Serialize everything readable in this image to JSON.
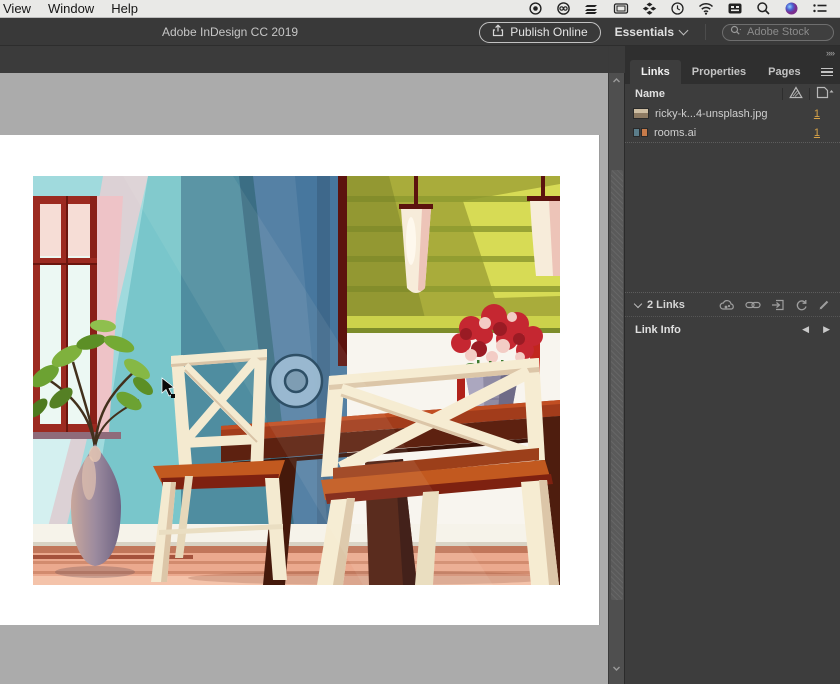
{
  "menubar": {
    "items": [
      {
        "label": "View"
      },
      {
        "label": "Window"
      },
      {
        "label": "Help"
      }
    ],
    "status_icons": [
      "record-icon",
      "creative-cloud-icon",
      "stack-icon",
      "display-icon",
      "dropbox-icon",
      "time-machine-icon",
      "wifi-icon",
      "input-source-icon",
      "spotlight-icon",
      "siri-icon",
      "notification-center-icon"
    ]
  },
  "titlebar": {
    "title": "Adobe InDesign CC 2019",
    "publish_button": "Publish Online",
    "workspace": "Essentials",
    "search_placeholder": "Adobe Stock"
  },
  "links_panel": {
    "tabs": [
      {
        "label": "Links"
      },
      {
        "label": "Properties"
      },
      {
        "label": "Pages"
      }
    ],
    "column_header": "Name",
    "rows": [
      {
        "name": "ricky-k...4-unsplash.jpg",
        "page": "1"
      },
      {
        "name": "rooms.ai",
        "page": "1"
      }
    ],
    "footer": {
      "count_label": "2 Links"
    },
    "link_info_label": "Link Info",
    "footer_icon_names": [
      "cc-libraries-icon",
      "relink-icon",
      "go-to-link-icon",
      "update-link-icon",
      "edit-original-icon"
    ],
    "header_icon_names": [
      "warning-icon",
      "page-sort-icon"
    ]
  },
  "canvas": {
    "illustration_alt": "Cartoon dining room: red-framed window and leafy plant in a purple vase on the left, teal and blue panelled walls, olive-green blind with cream pendant lamps on the right, dark wooden table with red roses in a grey vase and two cream cross-back chairs on a salmon wood floor; a grey loading spinner overlays the middle",
    "spinner": "loading-spinner"
  },
  "colors": {
    "appbar_bg": "#393939",
    "panel_bg": "#3d3d3d",
    "pasteboard": "#ababab",
    "page_number_gold": "#d7a348",
    "menubar_bg": "#e9e9e7"
  }
}
